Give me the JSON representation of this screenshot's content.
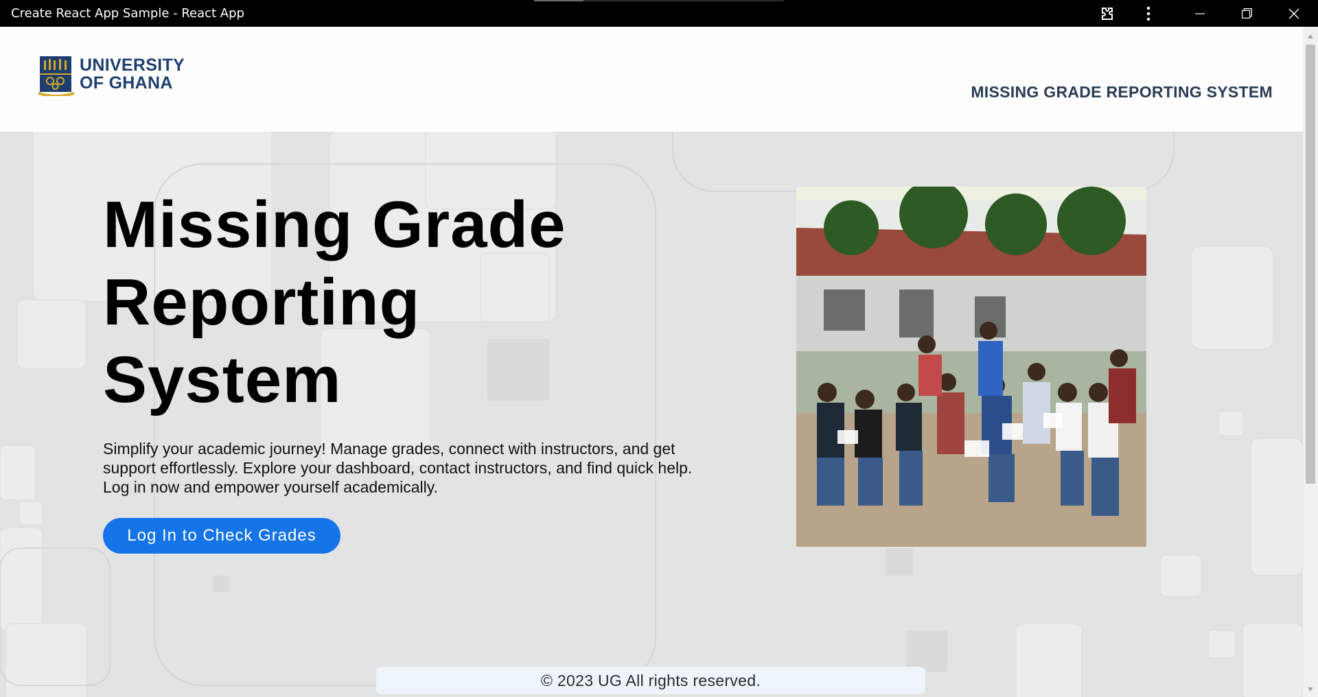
{
  "window": {
    "title": "Create React App Sample - React App",
    "controls": [
      "extension-icon",
      "more-options-icon",
      "minimize-icon",
      "restore-icon",
      "close-icon"
    ]
  },
  "header": {
    "logo_line1": "UNIVERSITY",
    "logo_line2": "OF GHANA",
    "system_title": "MISSING GRADE REPORTING SYSTEM"
  },
  "hero": {
    "title_line1": "Missing Grade",
    "title_line2": "Reporting",
    "title_line3": "System",
    "description": "Simplify your academic journey! Manage grades, connect with instructors, and get support effortlessly. Explore your dashboard, contact instructors, and find quick help. Log in now and empower yourself academically.",
    "cta_label": "Log In to Check Grades"
  },
  "footer": {
    "copyright": "© 2023 UG All rights reserved."
  },
  "colors": {
    "brand_blue": "#1e3f6e",
    "cta_blue": "#1474e8",
    "titlebar": "#000000"
  }
}
